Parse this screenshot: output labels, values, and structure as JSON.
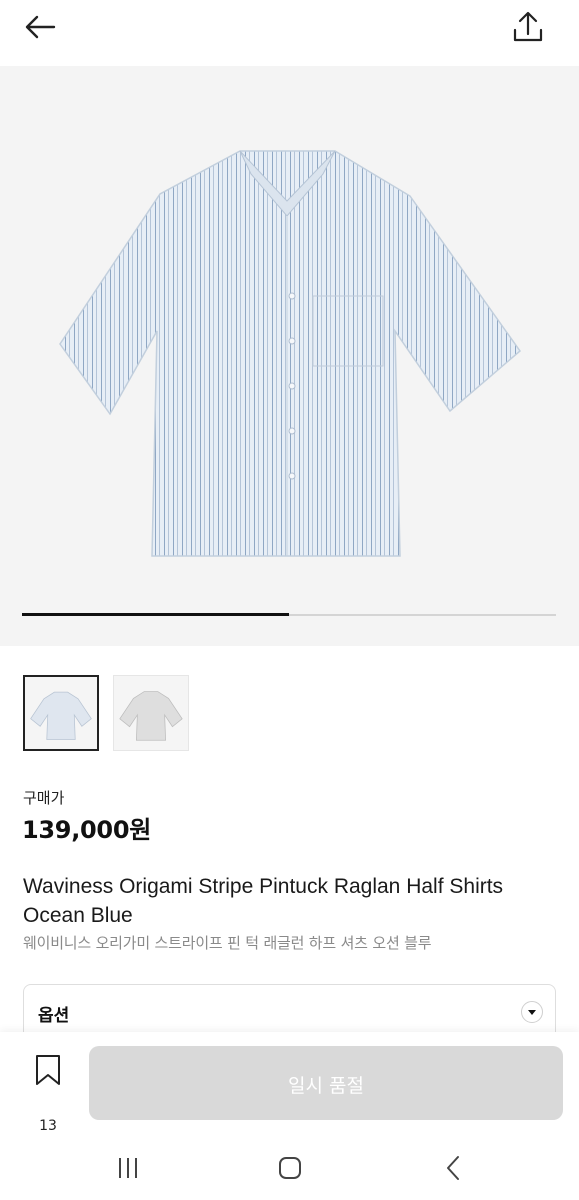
{
  "header": {
    "back_icon": "arrow-left-icon",
    "share_icon": "share-upload-icon"
  },
  "gallery": {
    "slide_progress": 0.5,
    "image": "striped-short-sleeve-shirt",
    "thumbnails": [
      {
        "color": "#dfe6ef",
        "selected": true
      },
      {
        "color": "#dedede",
        "selected": false
      }
    ]
  },
  "product": {
    "price_label": "구매가",
    "price": "139,000원",
    "name_en": "Waviness Origami Stripe Pintuck Raglan Half Shirts Ocean Blue",
    "name_ko": "웨이비니스 오리가미 스트라이프 핀 턱 래글런 하프 셔츠 오션 블루"
  },
  "options": {
    "label": "옵션",
    "icon": "chevron-down-icon"
  },
  "bottom_bar": {
    "wish_icon": "bookmark-icon",
    "wish_count": "13",
    "buy_label": "일시 품절",
    "buy_color": "#d9d9d9"
  },
  "system_nav": {
    "icons": [
      "recent-apps-icon",
      "home-icon",
      "back-icon"
    ]
  }
}
